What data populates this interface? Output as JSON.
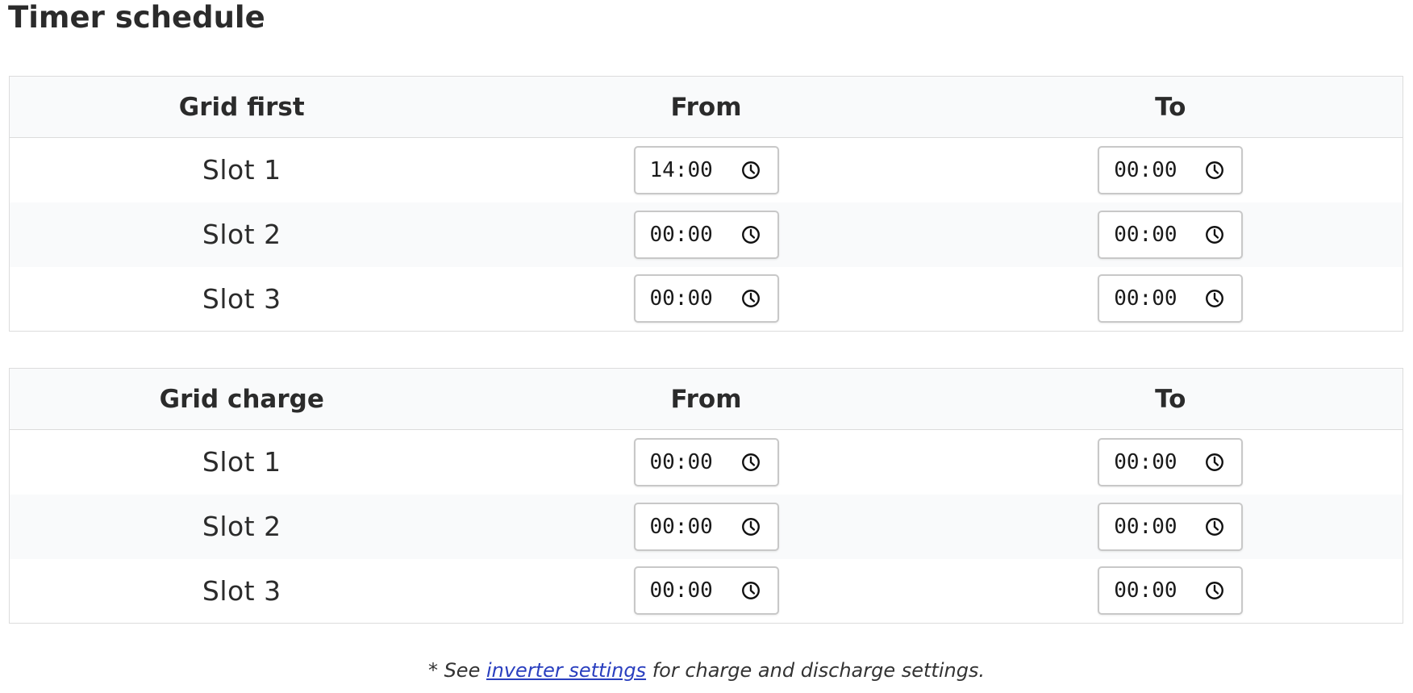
{
  "page": {
    "title": "Timer schedule"
  },
  "tables": [
    {
      "header": {
        "mode": "Grid first",
        "from": "From",
        "to": "To"
      },
      "rows": [
        {
          "slot": "Slot 1",
          "from": "14:00",
          "to": "00:00"
        },
        {
          "slot": "Slot 2",
          "from": "00:00",
          "to": "00:00"
        },
        {
          "slot": "Slot 3",
          "from": "00:00",
          "to": "00:00"
        }
      ]
    },
    {
      "header": {
        "mode": "Grid charge",
        "from": "From",
        "to": "To"
      },
      "rows": [
        {
          "slot": "Slot 1",
          "from": "00:00",
          "to": "00:00"
        },
        {
          "slot": "Slot 2",
          "from": "00:00",
          "to": "00:00"
        },
        {
          "slot": "Slot 3",
          "from": "00:00",
          "to": "00:00"
        }
      ]
    }
  ],
  "footnote": {
    "prefix": "* See ",
    "link_text": "inverter settings",
    "suffix": " for charge and discharge settings."
  },
  "icons": {
    "time_picker": "clock-icon"
  },
  "colors": {
    "link": "#2a3fbf",
    "header_bg": "#f9fafb",
    "border": "#dcdcdc"
  }
}
